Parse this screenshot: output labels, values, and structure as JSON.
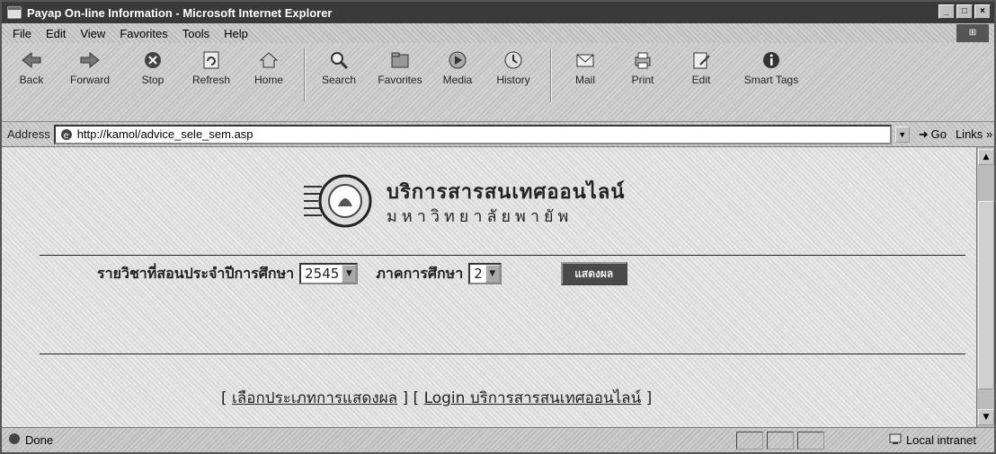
{
  "window": {
    "title": "Payap On-line Information - Microsoft Internet Explorer"
  },
  "menu": [
    "File",
    "Edit",
    "View",
    "Favorites",
    "Tools",
    "Help"
  ],
  "toolbar": {
    "buttons": [
      {
        "label": "Back",
        "icon": "back-arrow-icon"
      },
      {
        "label": "Forward",
        "icon": "forward-arrow-icon"
      },
      {
        "label": "Stop",
        "icon": "stop-icon"
      },
      {
        "label": "Refresh",
        "icon": "refresh-icon"
      },
      {
        "label": "Home",
        "icon": "home-icon"
      },
      {
        "label": "Search",
        "icon": "search-icon"
      },
      {
        "label": "Favorites",
        "icon": "favorites-icon"
      },
      {
        "label": "Media",
        "icon": "media-icon"
      },
      {
        "label": "History",
        "icon": "history-icon"
      },
      {
        "label": "Mail",
        "icon": "mail-icon"
      },
      {
        "label": "Print",
        "icon": "print-icon"
      },
      {
        "label": "Edit",
        "icon": "edit-icon"
      },
      {
        "label": "Smart Tags",
        "icon": "info-icon"
      }
    ]
  },
  "address": {
    "label": "Address",
    "url": "http://kamol/advice_sele_sem.asp",
    "go_label": "Go",
    "links_label": "Links"
  },
  "page": {
    "banner_line1": "บริการสารสนเทศออนไลน์",
    "banner_line2": "มหาวิทยาลัยพายัพ",
    "year_label": "รายวิชาที่สอนประจำปีการศึกษา",
    "year_value": "2545",
    "semester_label": "ภาคการศึกษา",
    "semester_value": "2",
    "submit_label": "แสดงผล",
    "link_bracket_open": "[",
    "link_bracket_mid": "] [",
    "link_bracket_close": "]",
    "link1": "เลือกประเภทการแสดงผล",
    "link2": "Login บริการสารสนเทศออนไลน์"
  },
  "status": {
    "text": "Done",
    "zone": "Local intranet"
  }
}
